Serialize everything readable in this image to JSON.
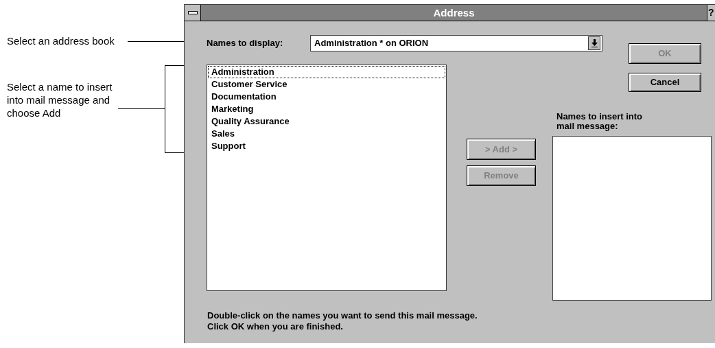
{
  "callouts": [
    "Select an address book",
    "Select a name to insert into mail message and choose Add"
  ],
  "window": {
    "title": "Address",
    "help": "?"
  },
  "names_to_display": {
    "label": "Names to display:",
    "value": "Administration * on ORION"
  },
  "names_list": [
    {
      "name": "Administration",
      "focused": true
    },
    {
      "name": "Customer Service",
      "focused": false
    },
    {
      "name": "Documentation",
      "focused": false
    },
    {
      "name": "Marketing",
      "focused": false
    },
    {
      "name": "Quality Assurance",
      "focused": false
    },
    {
      "name": "Sales",
      "focused": false
    },
    {
      "name": "Support",
      "focused": false
    }
  ],
  "buttons": [
    {
      "kind": "ok",
      "label": "OK",
      "disabled": true
    },
    {
      "kind": "cancel",
      "label": "Cancel",
      "disabled": false
    },
    {
      "kind": "add",
      "label": "> Add >",
      "disabled": true
    },
    {
      "kind": "remove",
      "label": "Remove",
      "disabled": true
    }
  ],
  "insert_label": "Names to insert into mail message:",
  "footer": [
    "Double-click on the names you want to send this mail message.",
    "Click OK when you are finished."
  ]
}
